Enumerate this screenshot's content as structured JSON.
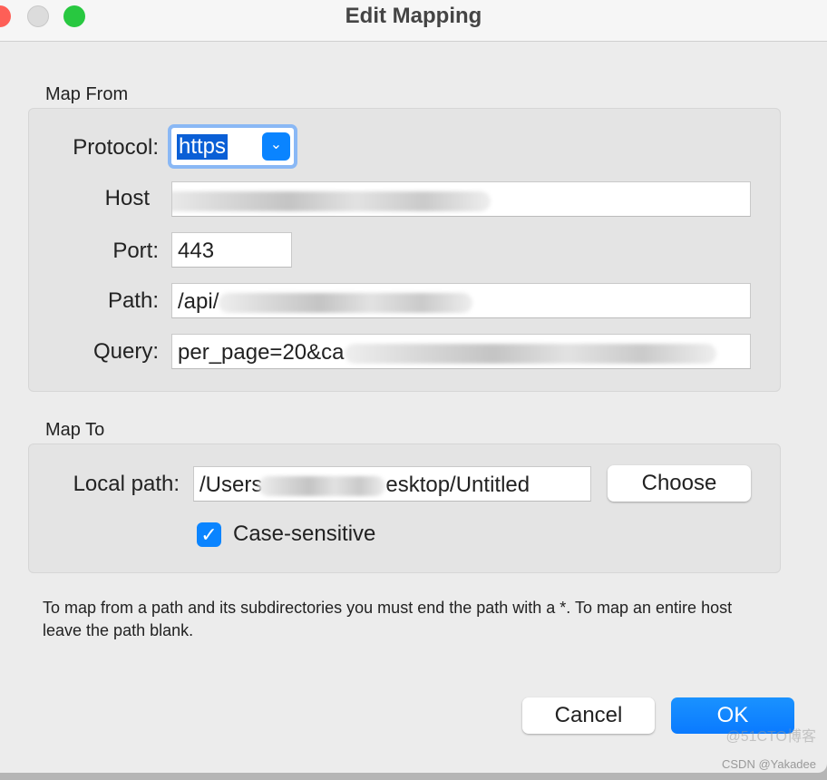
{
  "window": {
    "title": "Edit Mapping"
  },
  "map_from": {
    "heading": "Map From",
    "protocol_label": "Protocol:",
    "protocol_value": "https",
    "host_label": "Host",
    "host_value": "",
    "port_label": "Port:",
    "port_value": "443",
    "path_label": "Path:",
    "path_value": "/api/",
    "query_label": "Query:",
    "query_value": "per_page=20&ca"
  },
  "map_to": {
    "heading": "Map To",
    "local_path_label": "Local path:",
    "local_path_prefix": "/Users",
    "local_path_suffix": "esktop/Untitled",
    "choose_label": "Choose",
    "case_sensitive_label": "Case-sensitive",
    "case_sensitive_checked": true
  },
  "note": "To map from a path and its subdirectories you must end the path with a *. To map an entire host leave the path blank.",
  "buttons": {
    "cancel": "Cancel",
    "ok": "OK"
  },
  "watermark": {
    "line1": "@51CTO博客",
    "line2": "CSDN @Yakadee"
  },
  "colors": {
    "accent": "#0a84ff",
    "selection": "#0a5fd6"
  }
}
